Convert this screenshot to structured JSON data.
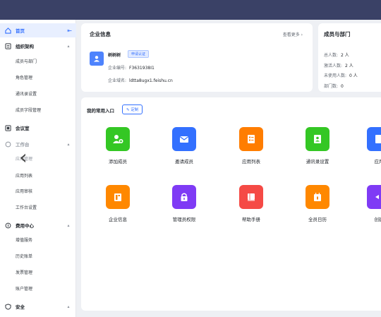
{
  "sidebar": {
    "items": [
      {
        "label": "首页",
        "icon": "home-icon",
        "active": true
      },
      {
        "label": "组织架构",
        "icon": "org-icon"
      },
      {
        "label": "成员与部门"
      },
      {
        "label": "角色管理"
      },
      {
        "label": "通讯录设置"
      },
      {
        "label": "成员字段管理"
      },
      {
        "label": "会议室",
        "icon": "meeting-room-icon"
      },
      {
        "label": "工作台",
        "icon": "workplace-icon"
      },
      {
        "label": "应用管理"
      },
      {
        "label": "应用列表"
      },
      {
        "label": "应用审核"
      },
      {
        "label": "工作台设置"
      },
      {
        "label": "费用中心",
        "icon": "billing-icon"
      },
      {
        "label": "增值服务"
      },
      {
        "label": "历史账单"
      },
      {
        "label": "发票管理"
      },
      {
        "label": "账户管理"
      },
      {
        "label": "安全",
        "icon": "security-icon"
      }
    ],
    "collapse_glyph": "⇤"
  },
  "enterprise": {
    "title": "企业信息",
    "more": "查看更多 ›",
    "name": "树树树",
    "badge": "申请认证",
    "id_label": "企业编号:",
    "id_value": "F3631938I1",
    "domain_label": "企业域名:",
    "domain_value": "ldtta8ugx1.feishu.cn"
  },
  "members": {
    "title": "成员与部门",
    "total_label": "总人数:",
    "total_value": "2 人",
    "active_label": "激活人数:",
    "active_value": "2 人",
    "inactive_label": "未使用人数:",
    "inactive_value": "0 人",
    "dept_label": "部门数:",
    "dept_value": "0"
  },
  "shortcuts": {
    "title": "我的常用入口",
    "custom_label": "✎ 定制",
    "tiles": [
      {
        "label": "添加成员",
        "color": "#34c724",
        "icon": "add-member-icon"
      },
      {
        "label": "邀请成员",
        "color": "#3370ff",
        "icon": "invite-mail-icon"
      },
      {
        "label": "应用列表",
        "color": "#ff7d00",
        "icon": "app-list-icon"
      },
      {
        "label": "通讯录设置",
        "color": "#34c724",
        "icon": "contacts-icon"
      },
      {
        "label": "应用",
        "color": "#3370ff",
        "icon": "app-icon"
      },
      {
        "label": "企业信息",
        "color": "#ff8800",
        "icon": "enterprise-info-icon"
      },
      {
        "label": "管理员权限",
        "color": "#7f3bf5",
        "icon": "admin-lock-icon"
      },
      {
        "label": "帮助手册",
        "color": "#f54a45",
        "icon": "help-book-icon"
      },
      {
        "label": "全员日历",
        "color": "#ff8800",
        "icon": "calendar-icon"
      },
      {
        "label": "创建",
        "color": "#7f3bf5",
        "icon": "create-icon"
      }
    ]
  },
  "nav": {
    "back_glyph": "‹"
  }
}
